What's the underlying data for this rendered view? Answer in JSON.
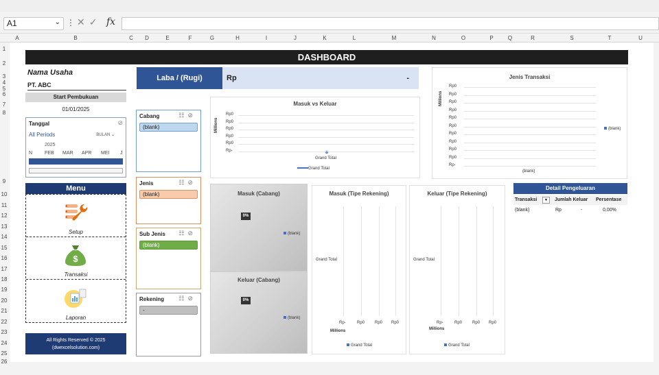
{
  "app": {
    "namebox": "A1",
    "columns": [
      "A",
      "B",
      "C",
      "D",
      "E",
      "F",
      "G",
      "H",
      "I",
      "J",
      "K",
      "L",
      "M",
      "N",
      "O",
      "P",
      "Q",
      "R",
      "S",
      "T",
      "U"
    ],
    "rows": [
      "1",
      "2",
      "3",
      "4",
      "5",
      "6",
      "7",
      "8",
      "9",
      "10",
      "11",
      "12",
      "13",
      "14",
      "15",
      "16",
      "17",
      "18",
      "19",
      "20",
      "21",
      "22",
      "23",
      "24",
      "25",
      "26"
    ]
  },
  "dashboard": {
    "title": "DASHBOARD",
    "business_label": "Nama Usaha",
    "business_name": "PT. ABC",
    "start_label": "Start Pembukuan",
    "start_date": "01/01/2025"
  },
  "timeline": {
    "title": "Tanggal",
    "periods": "All Periods",
    "level": "BULAN",
    "year": "2025",
    "months": [
      "N",
      "FEB",
      "MAR",
      "APR",
      "MEI",
      "J"
    ]
  },
  "menu": {
    "title": "Menu",
    "items": [
      {
        "label": "Setup",
        "icon": "setup-icon"
      },
      {
        "label": "Transaksi",
        "icon": "money-bag-icon"
      },
      {
        "label": "Laporan",
        "icon": "report-icon"
      }
    ]
  },
  "footer": {
    "line1": "All Rights Reserved © 2025",
    "line2": "(dwexcelsolution.com)"
  },
  "profit": {
    "label": "Laba / (Rugi)",
    "currency": "Rp",
    "value": "-"
  },
  "slicers": [
    {
      "title": "Cabang",
      "item": "(blank)",
      "color": "#bdd7ee",
      "border": "#6fa0d0"
    },
    {
      "title": "Jenis",
      "item": "(blank)",
      "color": "#f8cbad",
      "border": "#e0905e"
    },
    {
      "title": "Sub Jenis",
      "item": "(blank)",
      "color": "#70ad47",
      "border": "#5c9a3a"
    },
    {
      "title": "Rekening",
      "item": "-",
      "color": "#bfbfbf",
      "border": "#999999"
    }
  ],
  "charts": {
    "masuk_keluar": {
      "title": "Masuk vs Keluar",
      "ylabel": "Millions",
      "ticks": [
        "Rp0",
        "Rp0",
        "Rp0",
        "Rp0",
        "Rp0",
        "Rp-"
      ],
      "category": "Grand Total",
      "legend": "Grand Total"
    },
    "jenis_transaksi": {
      "title": "Jenis Transaksi",
      "ylabel": "Millions",
      "ticks": [
        "Rp0",
        "Rp0",
        "Rp0",
        "Rp0",
        "Rp0",
        "Rp0",
        "Rp0",
        "Rp0",
        "Rp0",
        "Rp0",
        "Rp-"
      ],
      "category": "(blank)",
      "legend": "(blank)"
    },
    "masuk_cabang": {
      "title": "Masuk (Cabang)",
      "badge": "0%",
      "legend": "(blank)"
    },
    "keluar_cabang": {
      "title": "Keluar (Cabang)",
      "badge": "0%",
      "legend": "(blank)"
    },
    "masuk_rekening": {
      "title": "Masuk (Tipe Rekening)",
      "category": "Grand Total",
      "ticks": [
        "Rp-",
        "Rp0",
        "Rp0",
        "Rp0"
      ],
      "xlabel": "Millions",
      "legend": "Grand Total"
    },
    "keluar_rekening": {
      "title": "Keluar (Tipe Rekening)",
      "category": "Grand Total",
      "ticks": [
        "Rp-",
        "Rp0",
        "Rp0",
        "Rp0"
      ],
      "xlabel": "Millions",
      "legend": "Grand Total"
    }
  },
  "detail": {
    "title": "Detail Pengeluaran",
    "columns": [
      "Transaksi",
      "Jumlah Keluar",
      "Persentase"
    ],
    "row": {
      "transaksi": "(blank)",
      "currency": "Rp",
      "amount": "-",
      "pct": "0,00%"
    }
  },
  "colors": {
    "navy": "#1f3b73",
    "accent": "#2f5597",
    "light": "#dae3f3",
    "dark": "#1f1f1f"
  }
}
